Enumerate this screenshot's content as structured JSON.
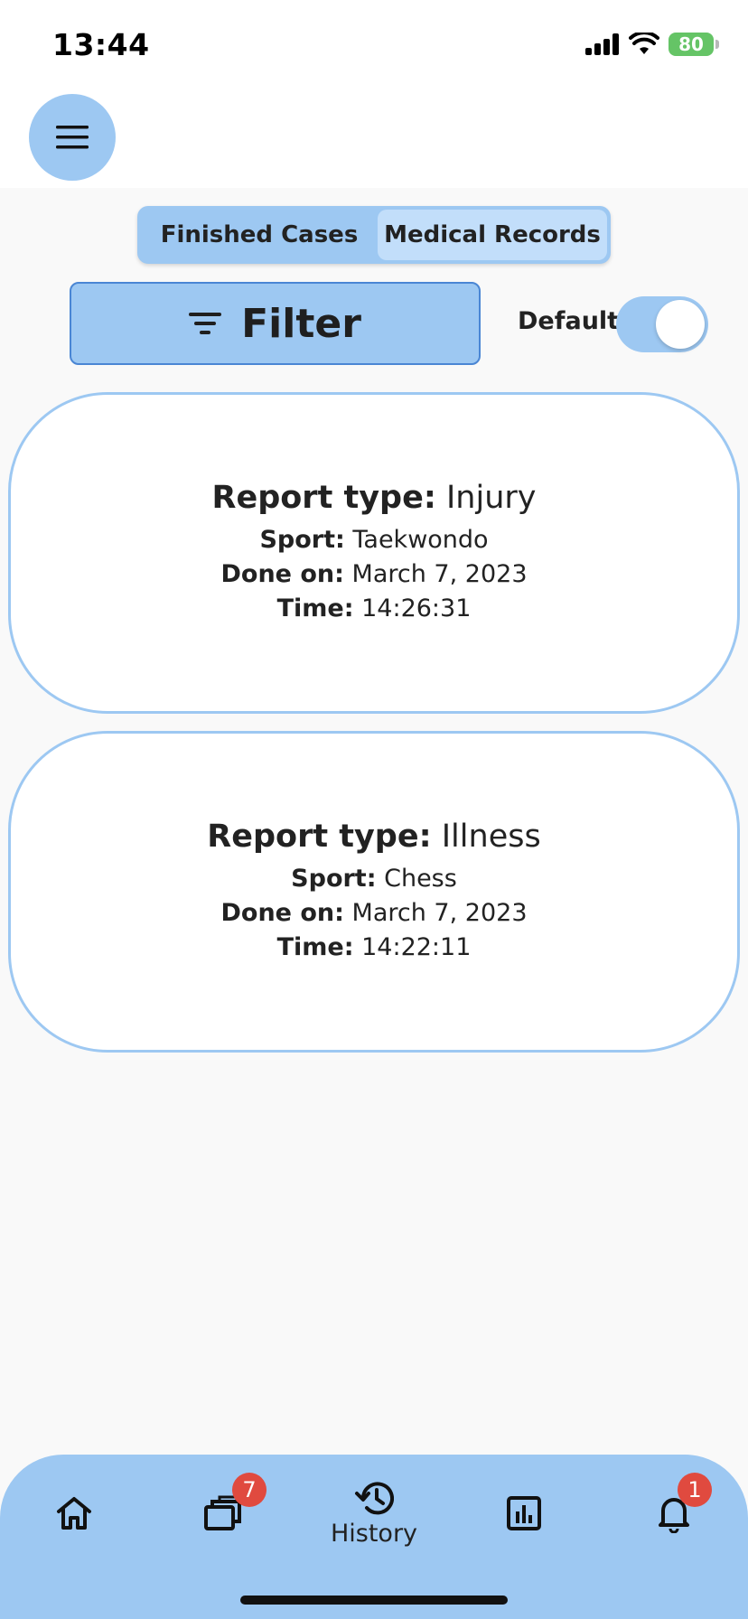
{
  "status_bar": {
    "time": "13:44",
    "battery": "80"
  },
  "header": {
    "menu_icon": "hamburger-menu-icon"
  },
  "segmented_control": {
    "tabs": [
      {
        "label": "Finished Cases",
        "selected": false
      },
      {
        "label": "Medical Records",
        "selected": true
      }
    ]
  },
  "filter": {
    "label": "Filter",
    "icon": "filter-icon"
  },
  "default_toggle": {
    "label": "Default",
    "on": true
  },
  "records": [
    {
      "report_type_label": "Report type:",
      "report_type": "Injury",
      "sport_label": "Sport:",
      "sport": "Taekwondo",
      "done_on_label": "Done on:",
      "done_on": "March 7, 2023",
      "time_label": "Time:",
      "time": "14:26:31"
    },
    {
      "report_type_label": "Report type:",
      "report_type": "Illness",
      "sport_label": "Sport:",
      "sport": "Chess",
      "done_on_label": "Done on:",
      "done_on": "March 7, 2023",
      "time_label": "Time:",
      "time": "14:22:11"
    }
  ],
  "tab_bar": {
    "items": [
      {
        "icon": "home-icon",
        "label": ""
      },
      {
        "icon": "cases-icon",
        "label": "",
        "badge": "7"
      },
      {
        "icon": "history-icon",
        "label": "History"
      },
      {
        "icon": "statistics-icon",
        "label": ""
      },
      {
        "icon": "bell-icon",
        "label": "",
        "badge": "1"
      }
    ]
  },
  "colors": {
    "accent": "#9dc8f2",
    "accent_light": "#c2defa",
    "badge": "#e04a3f",
    "battery": "#65c466"
  }
}
